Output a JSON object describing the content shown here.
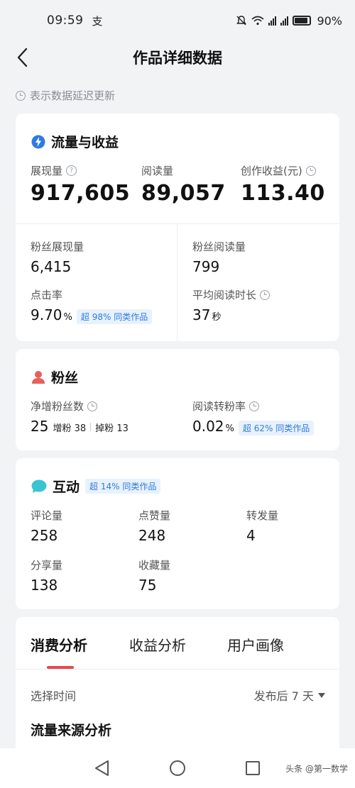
{
  "status": {
    "time": "09:59",
    "app_glyph": "支",
    "battery": "90%"
  },
  "nav": {
    "title": "作品详细数据"
  },
  "notice": "表示数据延迟更新",
  "traffic": {
    "title": "流量与收益",
    "impressions_label": "展现量",
    "impressions": "917,605",
    "reads_label": "阅读量",
    "reads": "89,057",
    "income_label": "创作收益(元)",
    "income": "113.40",
    "fan_impr_label": "粉丝展现量",
    "fan_impr": "6,415",
    "fan_read_label": "粉丝阅读量",
    "fan_read": "799",
    "ctr_label": "点击率",
    "ctr": "9.70",
    "ctr_unit": "%",
    "ctr_pill": "超 98% 同类作品",
    "avg_time_label": "平均阅读时长",
    "avg_time": "37",
    "avg_time_unit": "秒"
  },
  "fans": {
    "title": "粉丝",
    "net_label": "净增粉丝数",
    "net": "25",
    "gain_label": "增粉",
    "gain": "38",
    "loss_label": "掉粉",
    "loss": "13",
    "conv_label": "阅读转粉率",
    "conv": "0.02",
    "conv_unit": "%",
    "conv_pill": "超 62% 同类作品"
  },
  "interaction": {
    "title": "互动",
    "pill": "超 14% 同类作品",
    "comments_label": "评论量",
    "comments": "258",
    "likes_label": "点赞量",
    "likes": "248",
    "reposts_label": "转发量",
    "reposts": "4",
    "shares_label": "分享量",
    "shares": "138",
    "favs_label": "收藏量",
    "favs": "75"
  },
  "tabs": [
    {
      "label": "消费分析"
    },
    {
      "label": "收益分析"
    },
    {
      "label": "用户画像"
    }
  ],
  "filter": {
    "label": "选择时间",
    "value": "发布后 7 天"
  },
  "section_title": "流量来源分析",
  "watermark": "头条 @第一数学",
  "colors": {
    "accent_red": "#e8464b",
    "pill_blue": "#2f7be0",
    "bolt_blue": "#2f7be0",
    "fans_red": "#e8605c",
    "chat_teal": "#38c5d0"
  }
}
